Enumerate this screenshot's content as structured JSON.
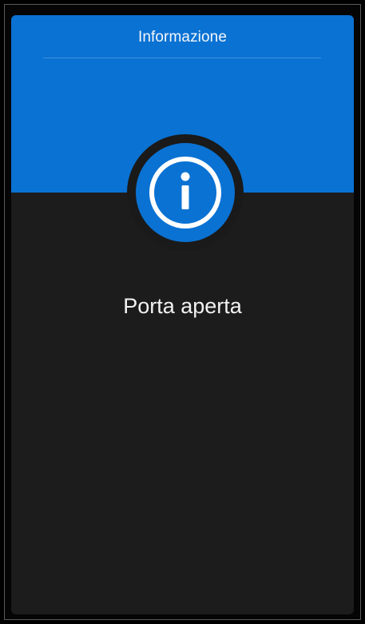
{
  "dialog": {
    "title": "Informazione",
    "message": "Porta aperta",
    "icon": "info-icon",
    "accent_color": "#0a72d3",
    "background_color": "#1c1c1c"
  }
}
